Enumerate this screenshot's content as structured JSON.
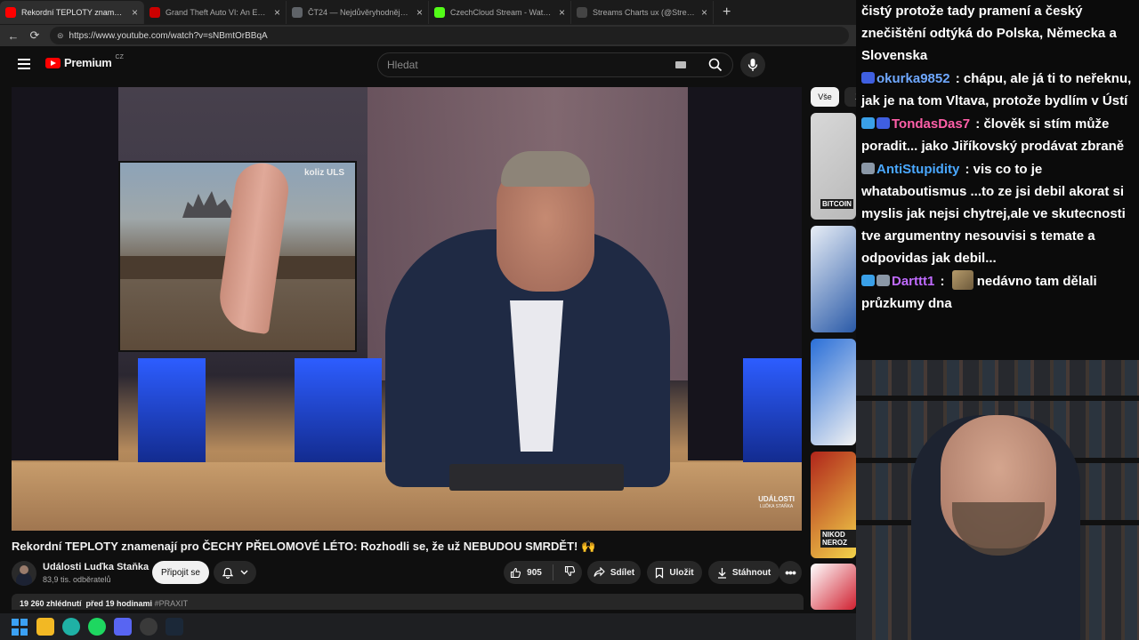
{
  "browser": {
    "tabs": [
      {
        "label": "Rekordní TEPLOTY znamenají",
        "favicon_color": "#ff0000",
        "active": true
      },
      {
        "label": "Grand Theft Auto VI: An Extended",
        "favicon_color": "#cc0000",
        "active": false
      },
      {
        "label": "ČT24 — Nejdůvěryhodnější zprav",
        "favicon_color": "#5f6368",
        "active": false
      },
      {
        "label": "CzechCloud Stream - Watch Live o",
        "favicon_color": "#53fc18",
        "active": false
      },
      {
        "label": "Streams Charts ux (@StreamsCha",
        "favicon_color": "#444444",
        "active": false
      }
    ],
    "close_glyph": "×",
    "new_tab_glyph": "+",
    "url": "https://www.youtube.com/watch?v=sNBmtOrBBqA"
  },
  "youtube": {
    "logo_text": "Premium",
    "logo_region": "CZ",
    "search_placeholder": "Hledat",
    "chips": [
      "Vše",
      "Z"
    ],
    "video": {
      "inset_tag": "koliz ULS",
      "watermark_top": "UDÁLOSTI",
      "watermark_bottom": "LUĎKA STAŇKA",
      "title": "Rekordní TEPLOTY znamenají pro ČECHY PŘELOMOVÉ LÉTO: Rozhodli se, že už NEBUDOU SMRDĚT! 🙌",
      "channel_name": "Události Luďka Staňka",
      "subscribers": "83,9 tis. odběratelů",
      "subscribe_label": "Připojit se",
      "likes": "905",
      "share_label": "Sdílet",
      "save_label": "Uložit",
      "download_label": "Stáhnout",
      "views": "19 260 zhlédnutí",
      "published": "před 19 hodinami",
      "hashtag": "#PRAXIT"
    },
    "related": [
      {
        "label": "BITCOIN",
        "colors": [
          "#d8d8d8",
          "#b9b9b9"
        ]
      },
      {
        "label": "",
        "colors": [
          "#e8eef6",
          "#2a5aa8"
        ]
      },
      {
        "label": "",
        "colors": [
          "#2a6fd8",
          "#f2f2f2"
        ]
      },
      {
        "label": "NIKOD NEROZ",
        "colors": [
          "#b0251b",
          "#f2d34a"
        ]
      },
      {
        "label": "",
        "colors": [
          "#ffffff",
          "#d02030"
        ]
      }
    ]
  },
  "chat": [
    {
      "badges": [],
      "user": "",
      "user_color": "#ffffff",
      "text": "čistý protože tady pramení a český znečištění odtýká do Polska, Německa a Slovenska",
      "emote": false,
      "text_after": ""
    },
    {
      "badges": [
        "#3f5fe0"
      ],
      "user": "okurka9852",
      "user_color": "#6fa8ff",
      "text": "chápu, ale já ti to neřeknu, jak je na tom Vltava, protože bydlím v Ústí",
      "emote": false,
      "text_after": ""
    },
    {
      "badges": [
        "#3aa0e8",
        "#3f5fe0"
      ],
      "user": "TondasDas7",
      "user_color": "#ff5fa8",
      "text": "člověk si stím může poradit... jako Jiříkovský prodávat zbraně",
      "emote": false,
      "text_after": ""
    },
    {
      "badges": [
        "#8a97a6"
      ],
      "user": "AntiStupidity",
      "user_color": "#4aa8ff",
      "text": "vis co to je whataboutismus ...to ze jsi debil akorat si myslis jak nejsi chytrej,ale ve skutecnosti tve argumentny nesouvisi s temate a odpovidas jak debil...",
      "emote": false,
      "text_after": ""
    },
    {
      "badges": [
        "#3aa0e8",
        "#8a97a6"
      ],
      "user": "Darttt1",
      "user_color": "#c06bff",
      "text": "",
      "emote": true,
      "text_after": "nedávno tam dělali průzkumy dna"
    }
  ],
  "taskbar": [
    {
      "name": "windows-start-icon",
      "color": "#3ba1f5"
    },
    {
      "name": "file-explorer-icon",
      "color": "#f2b824"
    },
    {
      "name": "edge-icon",
      "color": "#1fb1a5"
    },
    {
      "name": "spotify-icon",
      "color": "#1ed760"
    },
    {
      "name": "discord-icon",
      "color": "#5865f2"
    },
    {
      "name": "obs-icon",
      "color": "#3a3a3a"
    },
    {
      "name": "steam-icon",
      "color": "#1b2838"
    }
  ]
}
